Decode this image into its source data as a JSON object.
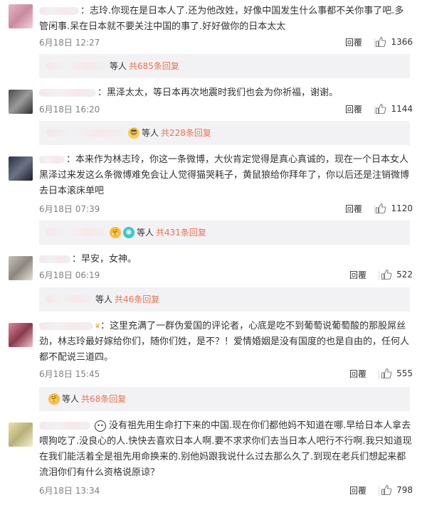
{
  "ui": {
    "reply_label": "回覆"
  },
  "comments": [
    {
      "text": "：志玲.你现在是日本人了.还为他改姓，好像中国发生什么事都不关你事了吧.多管闲事.呆在日本就不要关注中国的事了.好好做你的日本太太",
      "date": "6月18日 12:27",
      "likes": "1366",
      "deng": "等人",
      "sub_replies": "共685条回复"
    },
    {
      "text": "：黑泽太太，等日本再次地震时我们也会为你祈福，谢谢。",
      "date": "6月18日 16:20",
      "likes": "1144",
      "deng": "等人",
      "sub_replies": "共228条回复"
    },
    {
      "text": "：本来作为林志玲，你这一条微博，大伙肯定觉得是真心真诚的，现在一个日本女人黑泽过来发这么条微博难免会让人觉得猫哭耗子，黄鼠狼给你拜年了，你以后还是注销微博去日本滚床单吧",
      "date": "6月18日 07:39",
      "likes": "1120",
      "deng": "等人",
      "sub_replies": "共431条回复"
    },
    {
      "text": "：早安，女神。",
      "date": "6月18日 06:19",
      "likes": "522",
      "deng": "等人",
      "sub_replies": "共46条回复"
    },
    {
      "text": "：这里充满了一群伪爱国的评论者，心底是吃不到葡萄说葡萄酸的那股屌丝劲，林志玲最好嫁给你们，随你们姓，是不？！爱情婚姻是没有国度的也是自由的，任何人都不配说三道四。",
      "date": "6月18日 15:45",
      "likes": "555",
      "deng": "等人",
      "sub_replies": "共68条回复"
    },
    {
      "text": "没有祖先用生命打下来的中国.现在你们都他妈不知道在哪.早给日本人拿去喂狗吃了.没良心的人.快快去喜欢日本人啊.要不求求你们去当日本人吧行不行啊.我只知道现在我们能活着全是祖先用命换来的.别他妈跟我说什么过去那么久了.到现在老兵们想起来都流泪你们有什么资格说原谅？",
      "date": "6月18日 13:34",
      "likes": "798"
    }
  ]
}
